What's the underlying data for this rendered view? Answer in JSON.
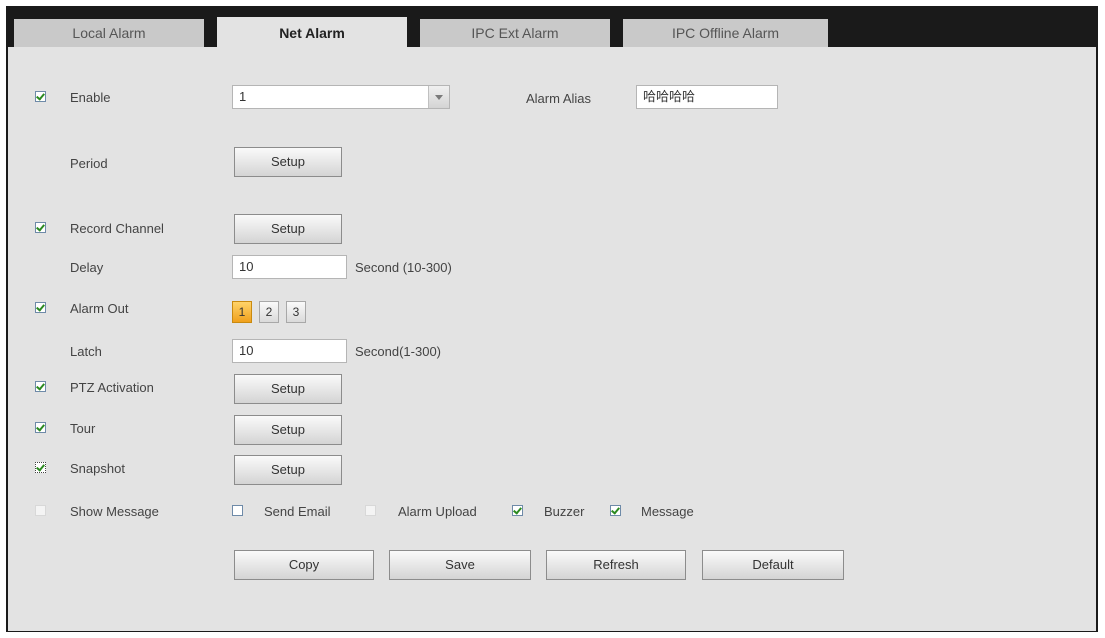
{
  "tabs": [
    {
      "label": "Local Alarm",
      "active": false
    },
    {
      "label": "Net Alarm",
      "active": true
    },
    {
      "label": "IPC Ext Alarm",
      "active": false
    },
    {
      "label": "IPC Offline Alarm",
      "active": false
    }
  ],
  "enable": {
    "label": "Enable",
    "checked": true,
    "channel_value": "1"
  },
  "alarm_alias": {
    "label": "Alarm Alias",
    "value": "哈哈哈哈"
  },
  "period": {
    "label": "Period",
    "button": "Setup"
  },
  "record_channel": {
    "label": "Record Channel",
    "checked": true,
    "button": "Setup"
  },
  "delay": {
    "label": "Delay",
    "value": "10",
    "unit": "Second (10-300)"
  },
  "alarm_out": {
    "label": "Alarm Out",
    "checked": true,
    "options": [
      "1",
      "2",
      "3"
    ],
    "selected": "1"
  },
  "latch": {
    "label": "Latch",
    "value": "10",
    "unit": "Second(1-300)"
  },
  "ptz_activation": {
    "label": "PTZ Activation",
    "checked": true,
    "button": "Setup"
  },
  "tour": {
    "label": "Tour",
    "checked": true,
    "button": "Setup"
  },
  "snapshot": {
    "label": "Snapshot",
    "checked": true,
    "button": "Setup"
  },
  "show_message": {
    "label": "Show Message",
    "checked": false
  },
  "send_email": {
    "label": "Send Email",
    "checked": false
  },
  "alarm_upload": {
    "label": "Alarm Upload",
    "checked": false
  },
  "buzzer": {
    "label": "Buzzer",
    "checked": true
  },
  "message": {
    "label": "Message",
    "checked": true
  },
  "actions": {
    "copy": "Copy",
    "save": "Save",
    "refresh": "Refresh",
    "default": "Default"
  },
  "colors": {
    "tabbar": "#1a1a1a",
    "panel": "#e3e3e3",
    "highlight": "#f0a01c",
    "check": "#2b8a1f"
  }
}
